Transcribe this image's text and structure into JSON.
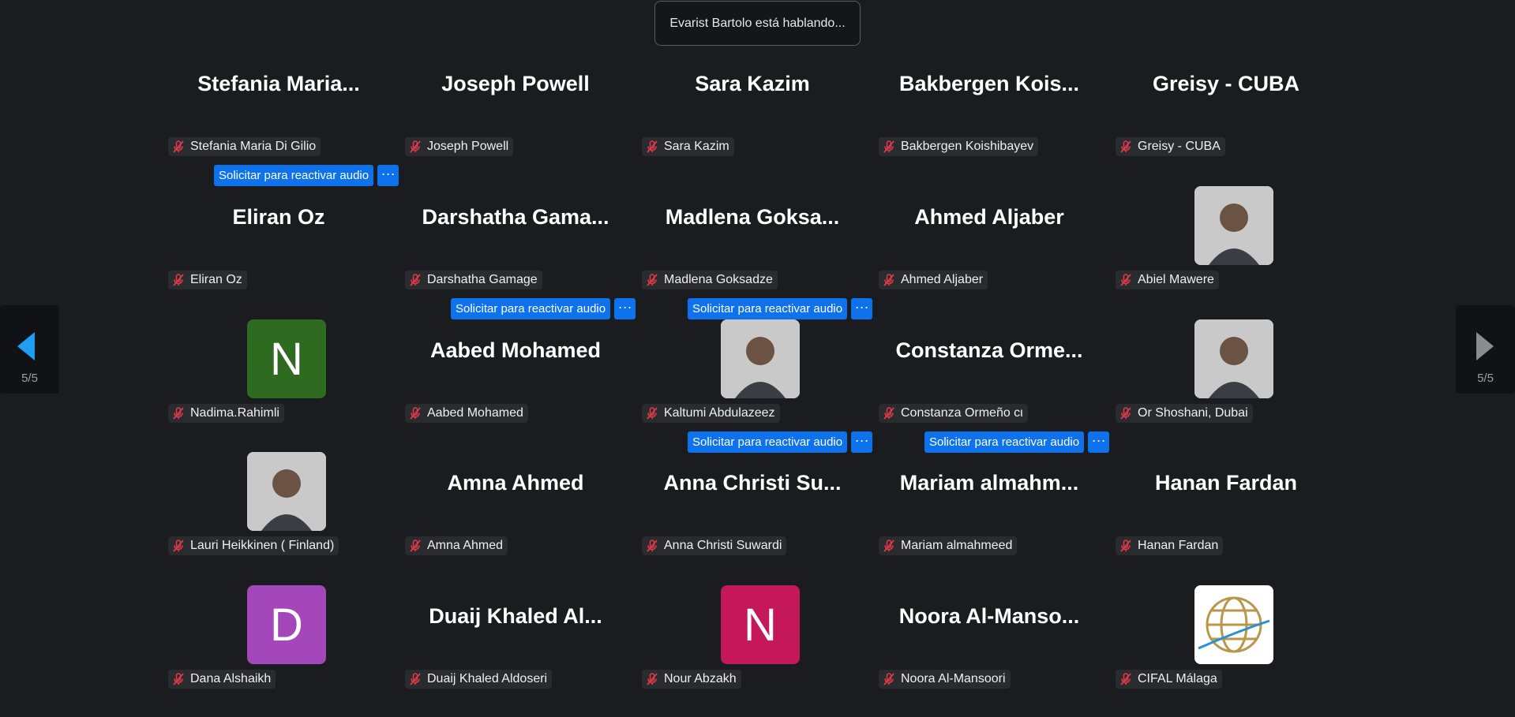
{
  "speaking_banner": "Evarist Bartolo está hablando...",
  "unmute_label": "Solicitar para reactivar audio",
  "more_label": "···",
  "nav": {
    "left_page": "5/5",
    "right_page": "5/5"
  },
  "colors": {
    "accent": "#0e72ed",
    "background": "#1a1c20",
    "mute_icon": "#e0394a"
  },
  "participants": [
    {
      "display": "Stefania  Maria...",
      "name": "Stefania Maria Di Gilio",
      "unmute": true
    },
    {
      "display": "Joseph Powell",
      "name": "Joseph Powell"
    },
    {
      "display": "Sara Kazim",
      "name": "Sara Kazim"
    },
    {
      "display": "Bakbergen  Kois...",
      "name": "Bakbergen Koishibayev"
    },
    {
      "display": "Greisy - CUBA",
      "name": "Greisy - CUBA"
    },
    {
      "display": "Eliran Oz",
      "name": "Eliran Oz"
    },
    {
      "display": "Darshatha  Gama...",
      "name": "Darshatha Gamage",
      "unmute": true
    },
    {
      "display": "Madlena  Goksa...",
      "name": "Madlena Goksadze",
      "unmute": true
    },
    {
      "display": "Ahmed Aljaber",
      "name": "Ahmed Aljaber"
    },
    {
      "photo": "avatar-photo",
      "name": "Abiel Mawere"
    },
    {
      "letter": "N",
      "color": "#2e6a1f",
      "name": "Nadima.Rahimli"
    },
    {
      "display": "Aabed Mohamed",
      "name": "Aabed Mohamed"
    },
    {
      "photo": "avatar-photo",
      "name": "Kaltumi Abdulazeez",
      "unmute": true
    },
    {
      "display": "Constanza  Orme...",
      "name": "Constanza Ormeño cι",
      "unmute": true
    },
    {
      "photo": "avatar-photo",
      "name": "Or Shoshani, Dubai"
    },
    {
      "photo": "avatar-photo",
      "name": "Lauri Heikkinen ( Finland)"
    },
    {
      "display": "Amna Ahmed",
      "name": "Amna Ahmed"
    },
    {
      "display": "Anna Christi Su...",
      "name": "Anna Christi Suwardi"
    },
    {
      "display": "Mariam  almahm...",
      "name": "Mariam almahmeed"
    },
    {
      "display": "Hanan Fardan",
      "name": "Hanan Fardan"
    },
    {
      "letter": "D",
      "color": "#a347ba",
      "name": "Dana Alshaikh"
    },
    {
      "display": "Duaij  Khaled Al...",
      "name": "Duaij Khaled Aldoseri"
    },
    {
      "letter": "N",
      "color": "#c4185a",
      "name": "Nour Abzakh"
    },
    {
      "display": "Noora  Al-Manso...",
      "name": "Noora Al-Mansoori"
    },
    {
      "photo": "logo",
      "name": "CIFAL Málaga"
    }
  ]
}
